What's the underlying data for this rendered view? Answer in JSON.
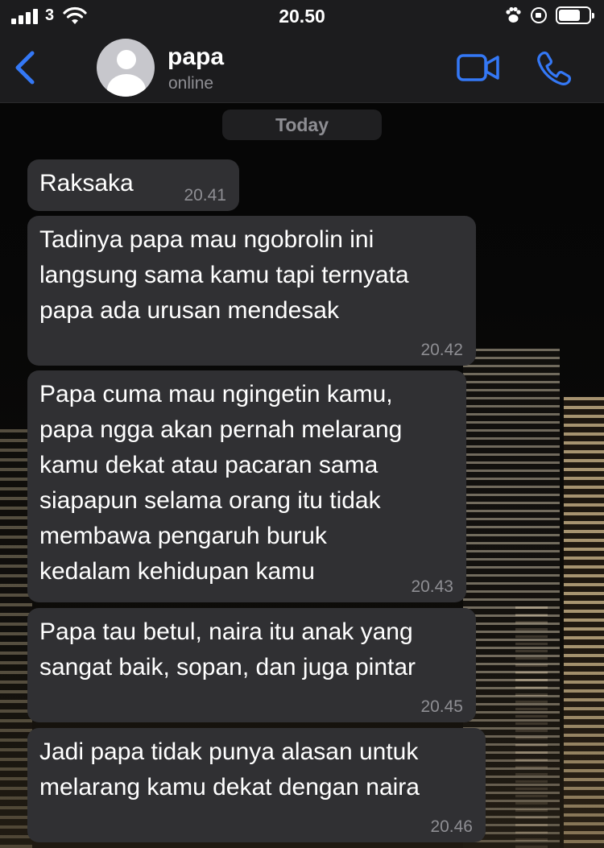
{
  "status_bar": {
    "carrier": "3",
    "time": "20.50"
  },
  "header": {
    "contact_name": "papa",
    "contact_status": "online"
  },
  "date_divider": "Today",
  "messages": [
    {
      "text": "Raksaka",
      "time": "20.41"
    },
    {
      "text": "Tadinya papa mau ngobrolin ini\nlangsung sama kamu tapi ternyata\npapa ada urusan mendesak",
      "time": "20.42"
    },
    {
      "text": "Papa cuma mau ngingetin kamu,\npapa ngga akan pernah melarang\nkamu dekat atau pacaran sama\nsiapapun selama orang itu tidak\nmembawa pengaruh buruk\nkedalam kehidupan kamu",
      "time": "20.43"
    },
    {
      "text": "Papa tau betul, naira itu anak yang\nsangat baik, sopan, dan juga pintar",
      "time": "20.45"
    },
    {
      "text": "Jadi papa tidak punya alasan untuk\nmelarang kamu dekat dengan naira",
      "time": "20.46"
    }
  ],
  "colors": {
    "accent": "#3478f6",
    "bubble": "#303033",
    "header_bg": "#1c1c1e",
    "secondary_text": "#8e8e93"
  },
  "icons": {
    "back": "chevron-left-icon",
    "video": "video-camera-icon",
    "call": "phone-icon"
  }
}
